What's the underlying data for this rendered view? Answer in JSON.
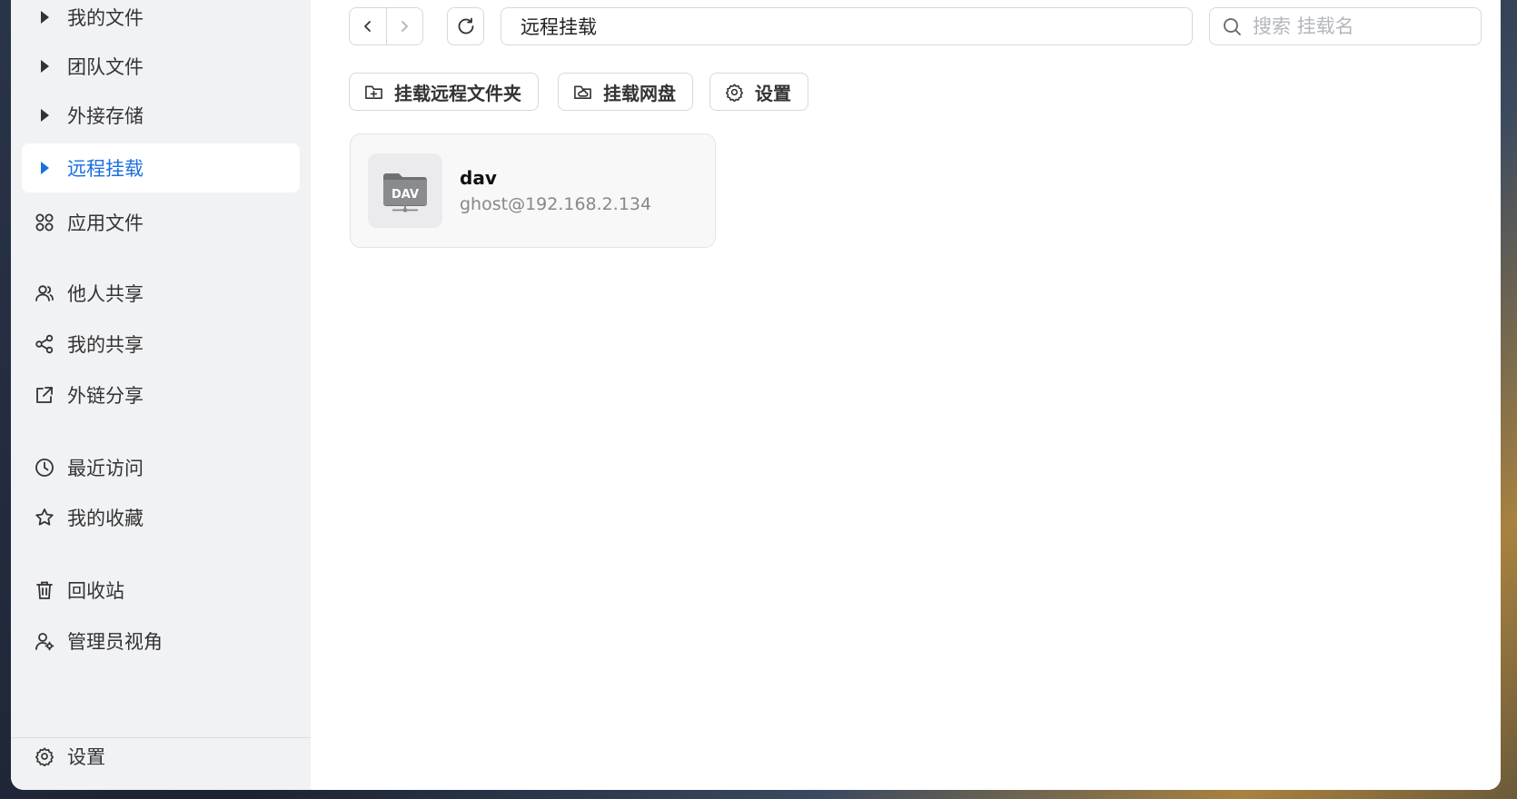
{
  "sidebar": {
    "items": [
      {
        "label": "我的文件",
        "icon": "caret-right-icon"
      },
      {
        "label": "团队文件",
        "icon": "caret-right-icon"
      },
      {
        "label": "外接存储",
        "icon": "caret-right-icon"
      },
      {
        "label": "远程挂载",
        "icon": "caret-right-icon",
        "active": true
      },
      {
        "label": "应用文件",
        "icon": "apps-grid-icon"
      },
      {
        "label": "他人共享",
        "icon": "users-icon"
      },
      {
        "label": "我的共享",
        "icon": "share-icon"
      },
      {
        "label": "外链分享",
        "icon": "external-share-icon"
      },
      {
        "label": "最近访问",
        "icon": "clock-icon"
      },
      {
        "label": "我的收藏",
        "icon": "star-icon"
      },
      {
        "label": "回收站",
        "icon": "trash-icon"
      },
      {
        "label": "管理员视角",
        "icon": "admin-user-icon"
      }
    ],
    "settings_label": "设置"
  },
  "toolbar": {
    "path": "远程挂载",
    "search_placeholder": "搜索 挂载名",
    "mount_remote_folder": "挂载远程文件夹",
    "mount_cloud_drive": "挂载网盘",
    "settings": "设置"
  },
  "mounts": [
    {
      "name": "dav",
      "address": "ghost@192.168.2.134",
      "badge": "DAV"
    }
  ],
  "colors": {
    "accent": "#1a6fe0",
    "sidebar_bg": "#f1f2f4"
  }
}
